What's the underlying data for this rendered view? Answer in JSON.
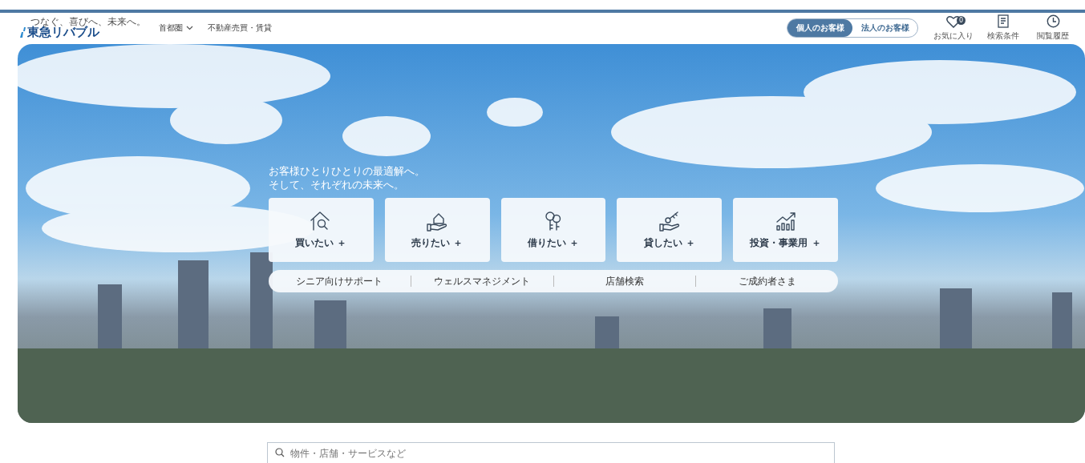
{
  "header": {
    "tagline": "つなぐ、喜びへ、未来へ。",
    "logo": "東急リバブル",
    "region_select": {
      "value": "首都圏"
    },
    "nav_link": "不動産売買・賃貸",
    "audience_tabs": [
      {
        "label": "個人のお客様",
        "selected": true
      },
      {
        "label": "法人のお客様",
        "selected": false
      }
    ],
    "tools": [
      {
        "kind": "favorite",
        "label": "お気に入り",
        "badge": "0"
      },
      {
        "kind": "conditions",
        "label": "検索条件"
      },
      {
        "kind": "history",
        "label": "閲覧履歴"
      }
    ]
  },
  "hero": {
    "headline": [
      "お客様ひとりひとりの最適解へ。",
      "そして、それぞれの未来へ。"
    ],
    "cards": [
      {
        "kind": "buy",
        "label": "買いたい ＋"
      },
      {
        "kind": "sell",
        "label": "売りたい ＋"
      },
      {
        "kind": "rent",
        "label": "借りたい ＋"
      },
      {
        "kind": "lend",
        "label": "貸したい ＋"
      },
      {
        "kind": "invest",
        "label": "投資・事業用 ＋"
      }
    ],
    "links": [
      "シニア向けサポート",
      "ウェルスマネジメント",
      "店舗検索",
      "ご成約者さま"
    ]
  },
  "search": {
    "placeholder": "物件・店舗・サービスなど"
  }
}
